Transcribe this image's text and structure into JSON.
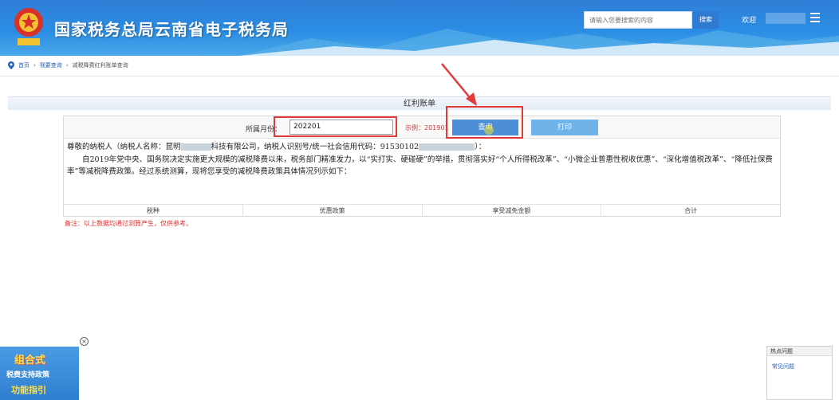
{
  "header": {
    "site_title": "国家税务总局云南省电子税务局",
    "search_placeholder": "请输入您要搜索的内容",
    "search_button": "搜索",
    "welcome": "欢迎"
  },
  "breadcrumb": {
    "home": "首页",
    "level2": "我要查询",
    "current": "减税降费红利账单查询"
  },
  "panel": {
    "title": "红利账单",
    "period_label": "所属月份：",
    "period_value": "202201",
    "hint": "示例：201901",
    "query_button": "查询",
    "print_button": "打印"
  },
  "letter": {
    "greeting": "尊敬的纳税人（纳税人名称：昆明",
    "greeting_mid": "科技有限公司，纳税人识别号/统一社会信用代码：91530102",
    "greeting_end": "）：",
    "body": "自2019年党中央、国务院决定实施更大规模的减税降费以来，税务部门精准发力，以“实打实、硬碰硬”的举措，贯彻落实好“个人所得税改革”、“小微企业普惠性税收优惠”、“深化增值税改革”、“降低社保费率”等减税降费政策。经过系统测算，现将您享受的减税降费政策具体情况列示如下："
  },
  "table": {
    "columns": [
      "税种",
      "优惠政策",
      "享受减免金额",
      "合计"
    ]
  },
  "remark": "备注：以上数据均通过测算产生，仅供参考。",
  "promo": {
    "line1": "组合式",
    "line2": "税费支持政策",
    "line3": "功能指引"
  },
  "mini_panel": {
    "head": "热点问题",
    "item": "常见问题"
  },
  "colors": {
    "header_blue": "#2a8de3",
    "highlight_red": "#e23a3a",
    "query_button": "#4d8ed8",
    "print_button": "#6fb3e8"
  }
}
